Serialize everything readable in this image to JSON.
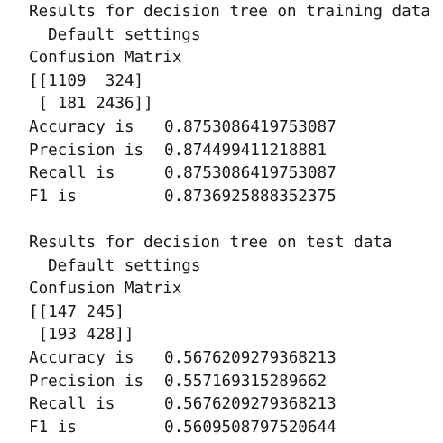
{
  "training": {
    "header": "Results for decision tree on training data",
    "settings": "Default settings",
    "matrix_title": "Confusion Matrix",
    "matrix_row_1": "[[1109  324]",
    "matrix_row_2": " [ 181 2436]]",
    "metrics": [
      {
        "label": "Accuracy is",
        "value": "0.8753086419753087"
      },
      {
        "label": "Precision is",
        "value": "0.874499411218881"
      },
      {
        "label": "Recall is",
        "value": "0.8753086419753087"
      },
      {
        "label": "F1 is",
        "value": "0.8736925888352375"
      }
    ]
  },
  "test": {
    "header": "Results for decision tree on test data",
    "settings": "Default settings",
    "matrix_title": "Confusion Matrix",
    "matrix_row_1": "[[147 245]",
    "matrix_row_2": " [193 428]]",
    "metrics": [
      {
        "label": "Accuracy is",
        "value": "0.5676209279368213"
      },
      {
        "label": "Precision is",
        "value": "0.557169315289662"
      },
      {
        "label": "Recall is",
        "value": "0.5676209279368213"
      },
      {
        "label": "F1 is",
        "value": "0.5609508797520644"
      }
    ]
  }
}
